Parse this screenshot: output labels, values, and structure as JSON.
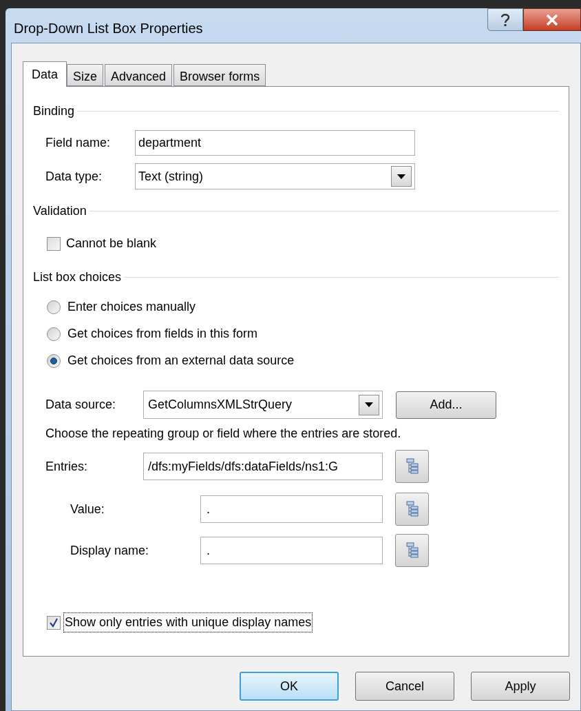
{
  "window": {
    "title": "Drop-Down List Box Properties"
  },
  "tabs": [
    {
      "label": "Data",
      "selected": true
    },
    {
      "label": "Size",
      "selected": false
    },
    {
      "label": "Advanced",
      "selected": false
    },
    {
      "label": "Browser forms",
      "selected": false
    }
  ],
  "binding": {
    "title": "Binding",
    "field_name": {
      "label": "Field name:",
      "value": "department"
    },
    "data_type": {
      "label": "Data type:",
      "value": "Text (string)"
    }
  },
  "validation": {
    "title": "Validation",
    "cannot_be_blank": {
      "label": "Cannot be blank",
      "checked": false
    }
  },
  "list_box_choices": {
    "title": "List box choices",
    "options": [
      {
        "label": "Enter choices manually",
        "selected": false
      },
      {
        "label": "Get choices from fields in this form",
        "selected": false
      },
      {
        "label": "Get choices from an external data source",
        "selected": true
      }
    ],
    "data_source": {
      "label": "Data source:",
      "value": "GetColumnsXMLStrQuery"
    },
    "add_button": "Add...",
    "instruction": "Choose the repeating group or field where the entries are stored.",
    "entries": {
      "label": "Entries:",
      "value": "/dfs:myFields/dfs:dataFields/ns1:G"
    },
    "value": {
      "label": "Value:",
      "value": "."
    },
    "display_name": {
      "label": "Display name:",
      "value": "."
    },
    "unique_names": {
      "label": "Show only entries with unique display names",
      "checked": true,
      "focused": true
    }
  },
  "buttons": [
    {
      "label": "OK",
      "default": true
    },
    {
      "label": "Cancel",
      "default": false
    },
    {
      "label": "Apply",
      "default": false
    }
  ]
}
